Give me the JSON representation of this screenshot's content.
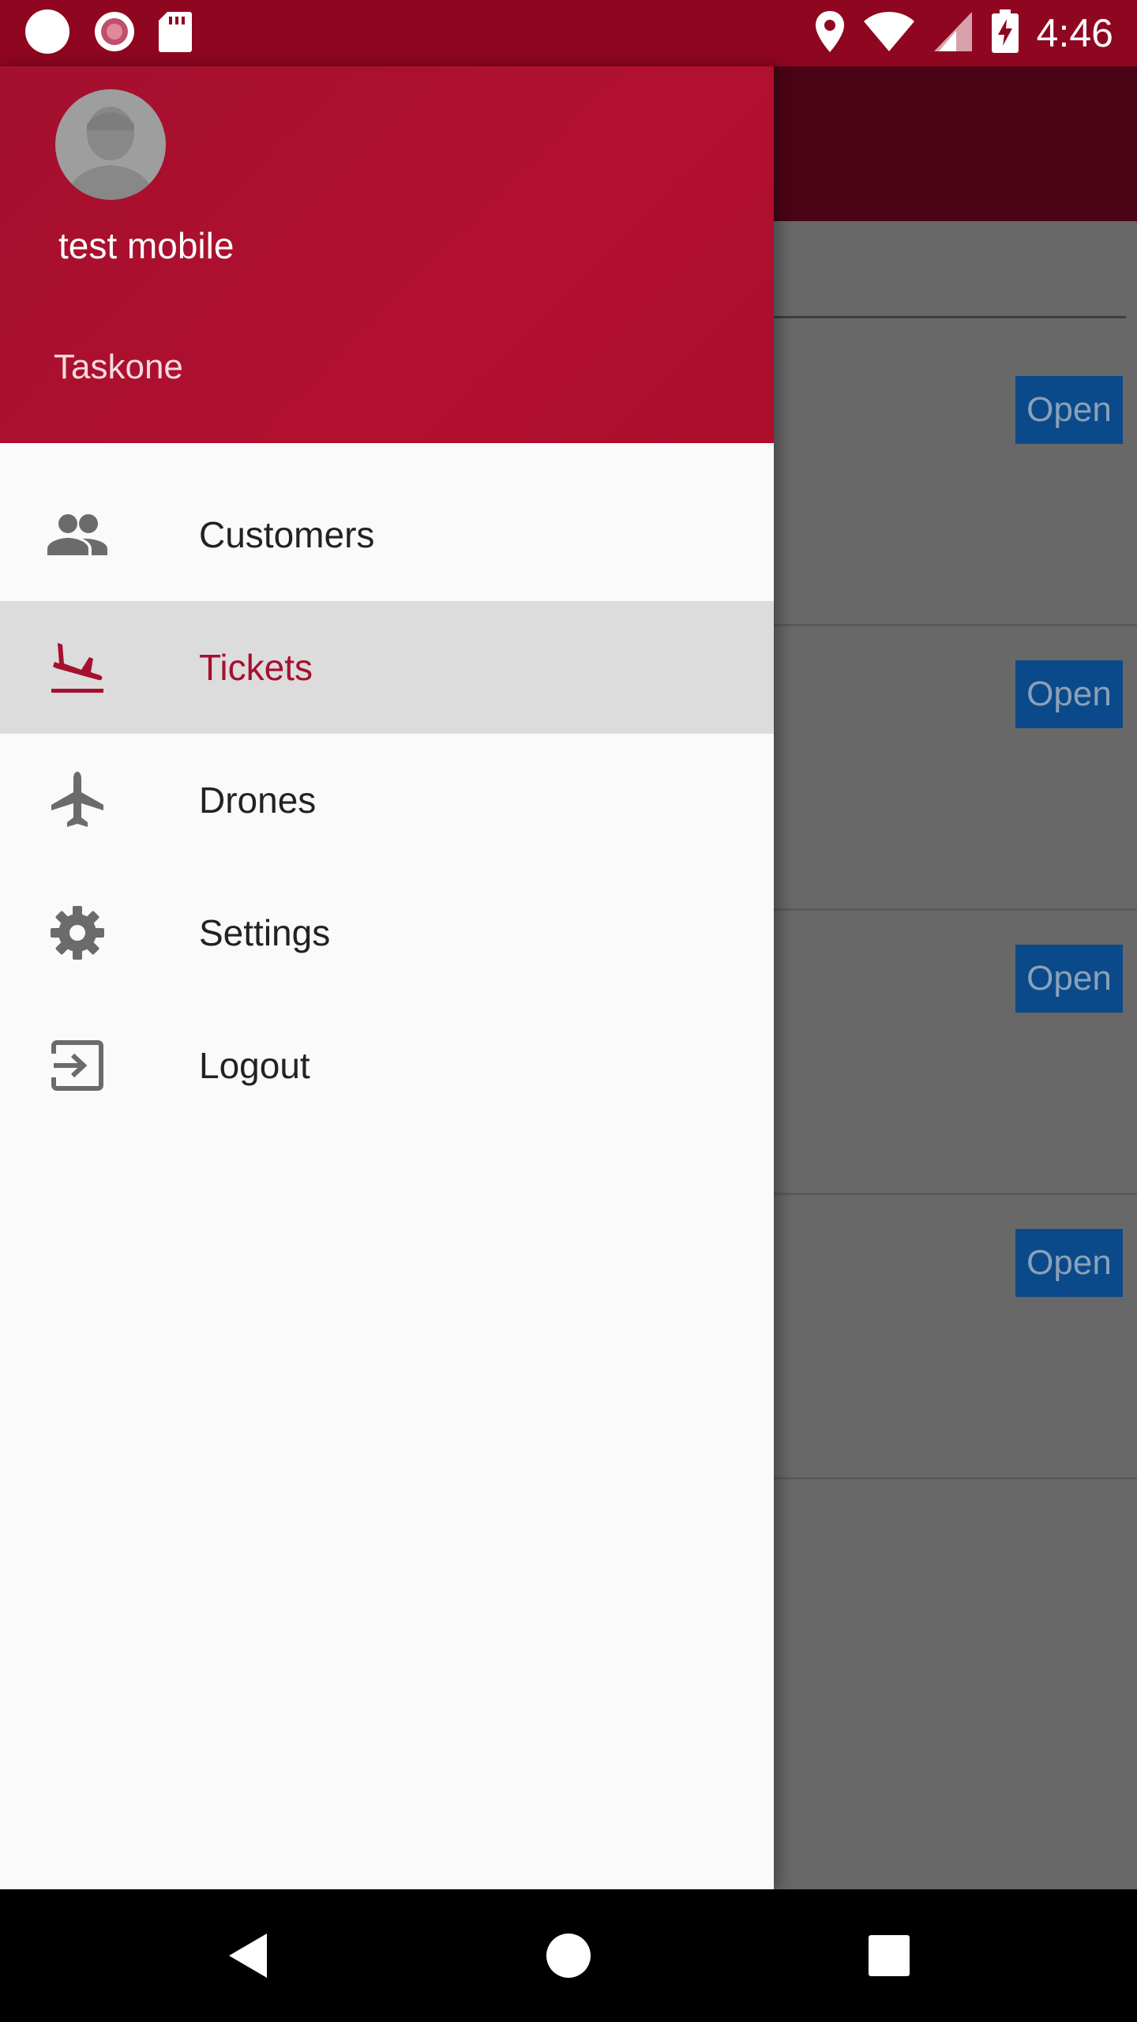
{
  "status_bar": {
    "time": "4:46",
    "left_icons": [
      "circle-notification-icon",
      "record-icon",
      "sd-card-icon"
    ],
    "right_icons": [
      "location-icon",
      "wifi-icon",
      "cell-signal-icon",
      "battery-charging-icon"
    ]
  },
  "drawer": {
    "user_name": "test mobile",
    "org_name": "Taskone",
    "items": [
      {
        "label": "Customers",
        "icon": "people-icon",
        "active": false
      },
      {
        "label": "Tickets",
        "icon": "flight-land-icon",
        "active": true
      },
      {
        "label": "Drones",
        "icon": "airplane-icon",
        "active": false
      },
      {
        "label": "Settings",
        "icon": "gear-icon",
        "active": false
      },
      {
        "label": "Logout",
        "icon": "exit-icon",
        "active": false
      }
    ]
  },
  "background": {
    "cards": [
      {
        "status": "Open"
      },
      {
        "status": "Open"
      },
      {
        "status": "Open"
      },
      {
        "status": "Open"
      }
    ]
  },
  "colors": {
    "status_bar": "#8f0620",
    "header": "#b2102f",
    "accent": "#a6102f",
    "open_badge": "#0b4a8a"
  }
}
